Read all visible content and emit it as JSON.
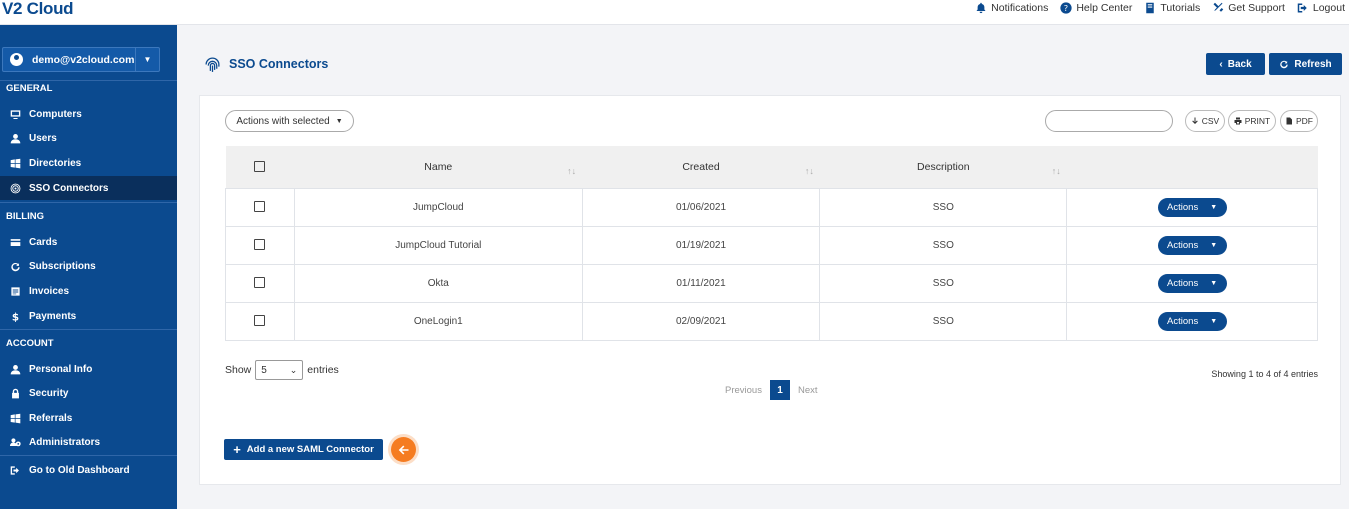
{
  "brand": "V2 Cloud",
  "topnav": [
    {
      "label": "Notifications",
      "icon": "bell-icon"
    },
    {
      "label": "Help Center",
      "icon": "help-icon"
    },
    {
      "label": "Tutorials",
      "icon": "book-icon"
    },
    {
      "label": "Get Support",
      "icon": "tools-icon"
    },
    {
      "label": "Logout",
      "icon": "logout-icon"
    }
  ],
  "account": {
    "email": "demo@v2cloud.com"
  },
  "sidebar": {
    "general_label": "GENERAL",
    "general": [
      {
        "label": "Computers",
        "icon": "monitor-icon"
      },
      {
        "label": "Users",
        "icon": "user-icon"
      },
      {
        "label": "Directories",
        "icon": "windows-icon"
      },
      {
        "label": "SSO Connectors",
        "icon": "fingerprint-icon",
        "active": true
      }
    ],
    "billing_label": "BILLING",
    "billing": [
      {
        "label": "Cards",
        "icon": "card-icon"
      },
      {
        "label": "Subscriptions",
        "icon": "refresh-icon"
      },
      {
        "label": "Invoices",
        "icon": "invoice-icon"
      },
      {
        "label": "Payments",
        "icon": "dollar-icon"
      }
    ],
    "account_label": "ACCOUNT",
    "account": [
      {
        "label": "Personal Info",
        "icon": "user-icon"
      },
      {
        "label": "Security",
        "icon": "lock-icon"
      },
      {
        "label": "Referrals",
        "icon": "windows-icon"
      },
      {
        "label": "Administrators",
        "icon": "users-cog-icon"
      }
    ],
    "old_dashboard": "Go to Old Dashboard"
  },
  "page": {
    "title": "SSO Connectors",
    "back_label": "Back",
    "refresh_label": "Refresh"
  },
  "toolbar": {
    "actions_with_selected": "Actions with selected",
    "search_placeholder": "",
    "csv": "CSV",
    "print": "PRINT",
    "pdf": "PDF"
  },
  "table": {
    "columns": [
      "Name",
      "Created",
      "Description"
    ],
    "rows": [
      {
        "name": "JumpCloud",
        "created": "01/06/2021",
        "description": "SSO",
        "action": "Actions"
      },
      {
        "name": "JumpCloud Tutorial",
        "created": "01/19/2021",
        "description": "SSO",
        "action": "Actions"
      },
      {
        "name": "Okta",
        "created": "01/11/2021",
        "description": "SSO",
        "action": "Actions"
      },
      {
        "name": "OneLogin1",
        "created": "02/09/2021",
        "description": "SSO",
        "action": "Actions"
      }
    ]
  },
  "footer": {
    "show_label": "Show",
    "entries_value": "5",
    "entries_label": "entries",
    "showing": "Showing 1 to 4 of 4 entries",
    "previous": "Previous",
    "page": "1",
    "next": "Next",
    "add_button": "Add a new SAML Connector"
  },
  "colors": {
    "primary": "#0b4a8f",
    "active_bg": "#0a2f5c",
    "accent": "#f57c21"
  }
}
